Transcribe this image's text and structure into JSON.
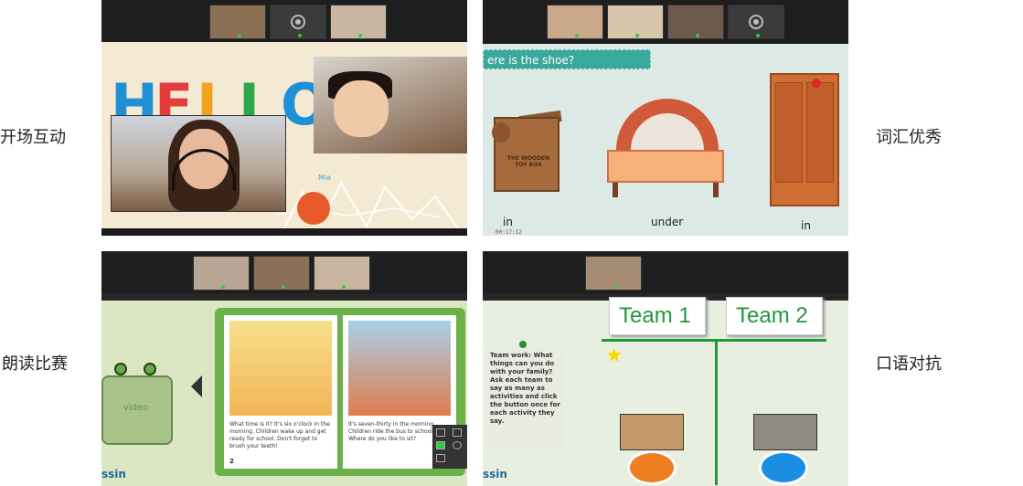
{
  "labels": {
    "top_left": "开场互动",
    "top_right": "词汇优秀",
    "bottom_left": "朗读比赛",
    "bottom_right": "口语对抗"
  },
  "shot1": {
    "hello_letters": [
      "H",
      "E",
      "L",
      "L",
      "O"
    ],
    "student_name": "Mia"
  },
  "shot2": {
    "question": "ere is the shoe?",
    "toybox_text": "THE WOODEN TOY BOX",
    "words": [
      "in",
      "under",
      "in"
    ],
    "timer": "00:17:12"
  },
  "shot3": {
    "left_page_text": "What time is it? It's six o'clock in the morning. Children wake up and get ready for school. Don't forget to brush your teeth!",
    "right_page_text": "It's seven-thirty in the morning. Children ride the bus to school. Where do you like to sit?",
    "left_page_number": "2",
    "video_label": "video",
    "logo": "ssin"
  },
  "shot4": {
    "team1": "Team 1",
    "team2": "Team 2",
    "star": "★",
    "note": "Team work: What things can you do with your family? Ask each team to say as many as activities and click the button once for each activity they say.",
    "logo": "ssin"
  },
  "colors": {
    "team_green": "#1d9a3a",
    "question_teal": "#3aa89b",
    "disc_orange": "#ef7d22",
    "disc_blue": "#1a8ee0"
  }
}
